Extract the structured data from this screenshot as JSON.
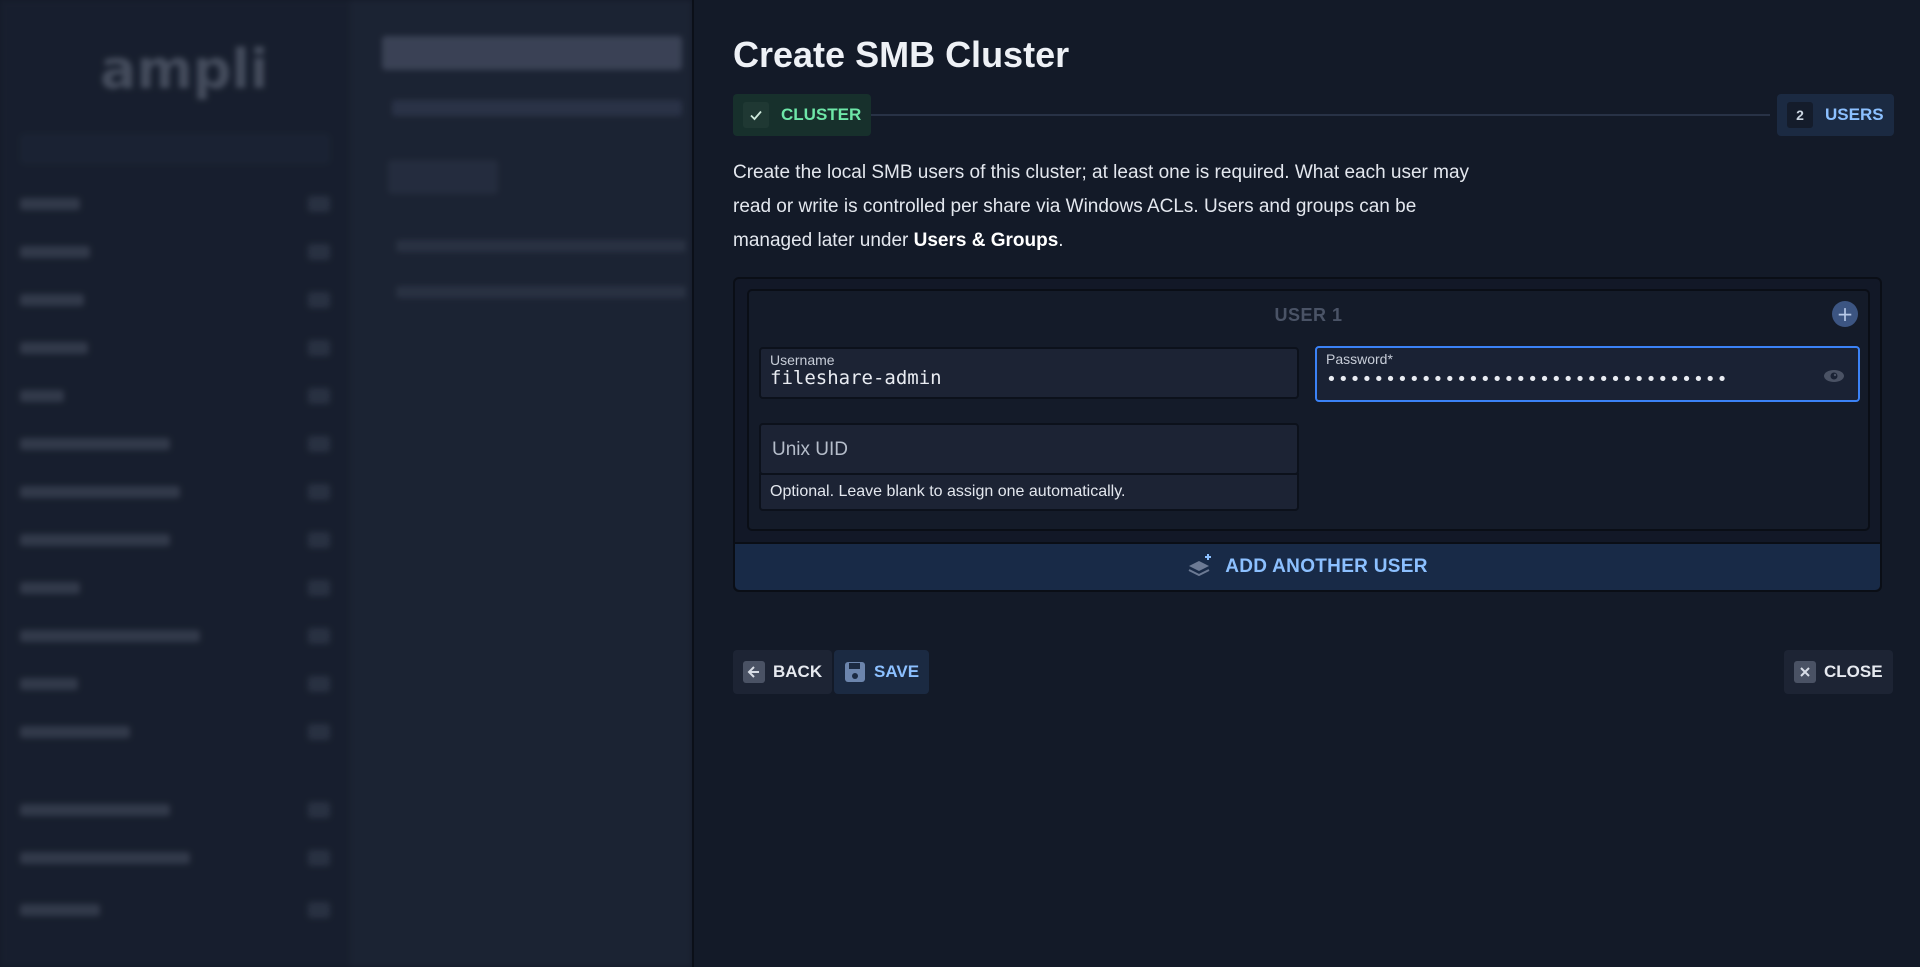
{
  "background_app": {
    "logo": "ampli"
  },
  "drawer": {
    "title": "Create SMB Cluster",
    "stepper": {
      "steps": [
        {
          "label": "CLUSTER",
          "state": "done"
        },
        {
          "number": "2",
          "label": "USERS",
          "state": "active"
        }
      ]
    },
    "description": {
      "text_before": "Create the local SMB users of this cluster; at least one is required. What each user may read or write is controlled per share via Windows ACLs. Users and groups can be managed later under ",
      "link": "Users & Groups",
      "text_after": "."
    },
    "user_card": {
      "heading": "USER 1",
      "add_icon": "plus-icon",
      "username": {
        "label": "Username",
        "value": "fileshare-admin"
      },
      "password": {
        "label": "Password*",
        "value": "••••••••••••••••••••••••••••••••••",
        "toggle_icon": "eye-icon"
      },
      "unix_uid": {
        "placeholder": "Unix UID",
        "helper": "Optional. Leave blank to assign one automatically."
      }
    },
    "add_user_label": "ADD ANOTHER USER",
    "footer": {
      "back_label": "BACK",
      "save_label": "SAVE",
      "close_label": "CLOSE"
    },
    "colors": {
      "accent": "#8cc0ff",
      "success": "#6ee7a8",
      "focus": "#3b82f6",
      "panel": "#131a28"
    }
  }
}
